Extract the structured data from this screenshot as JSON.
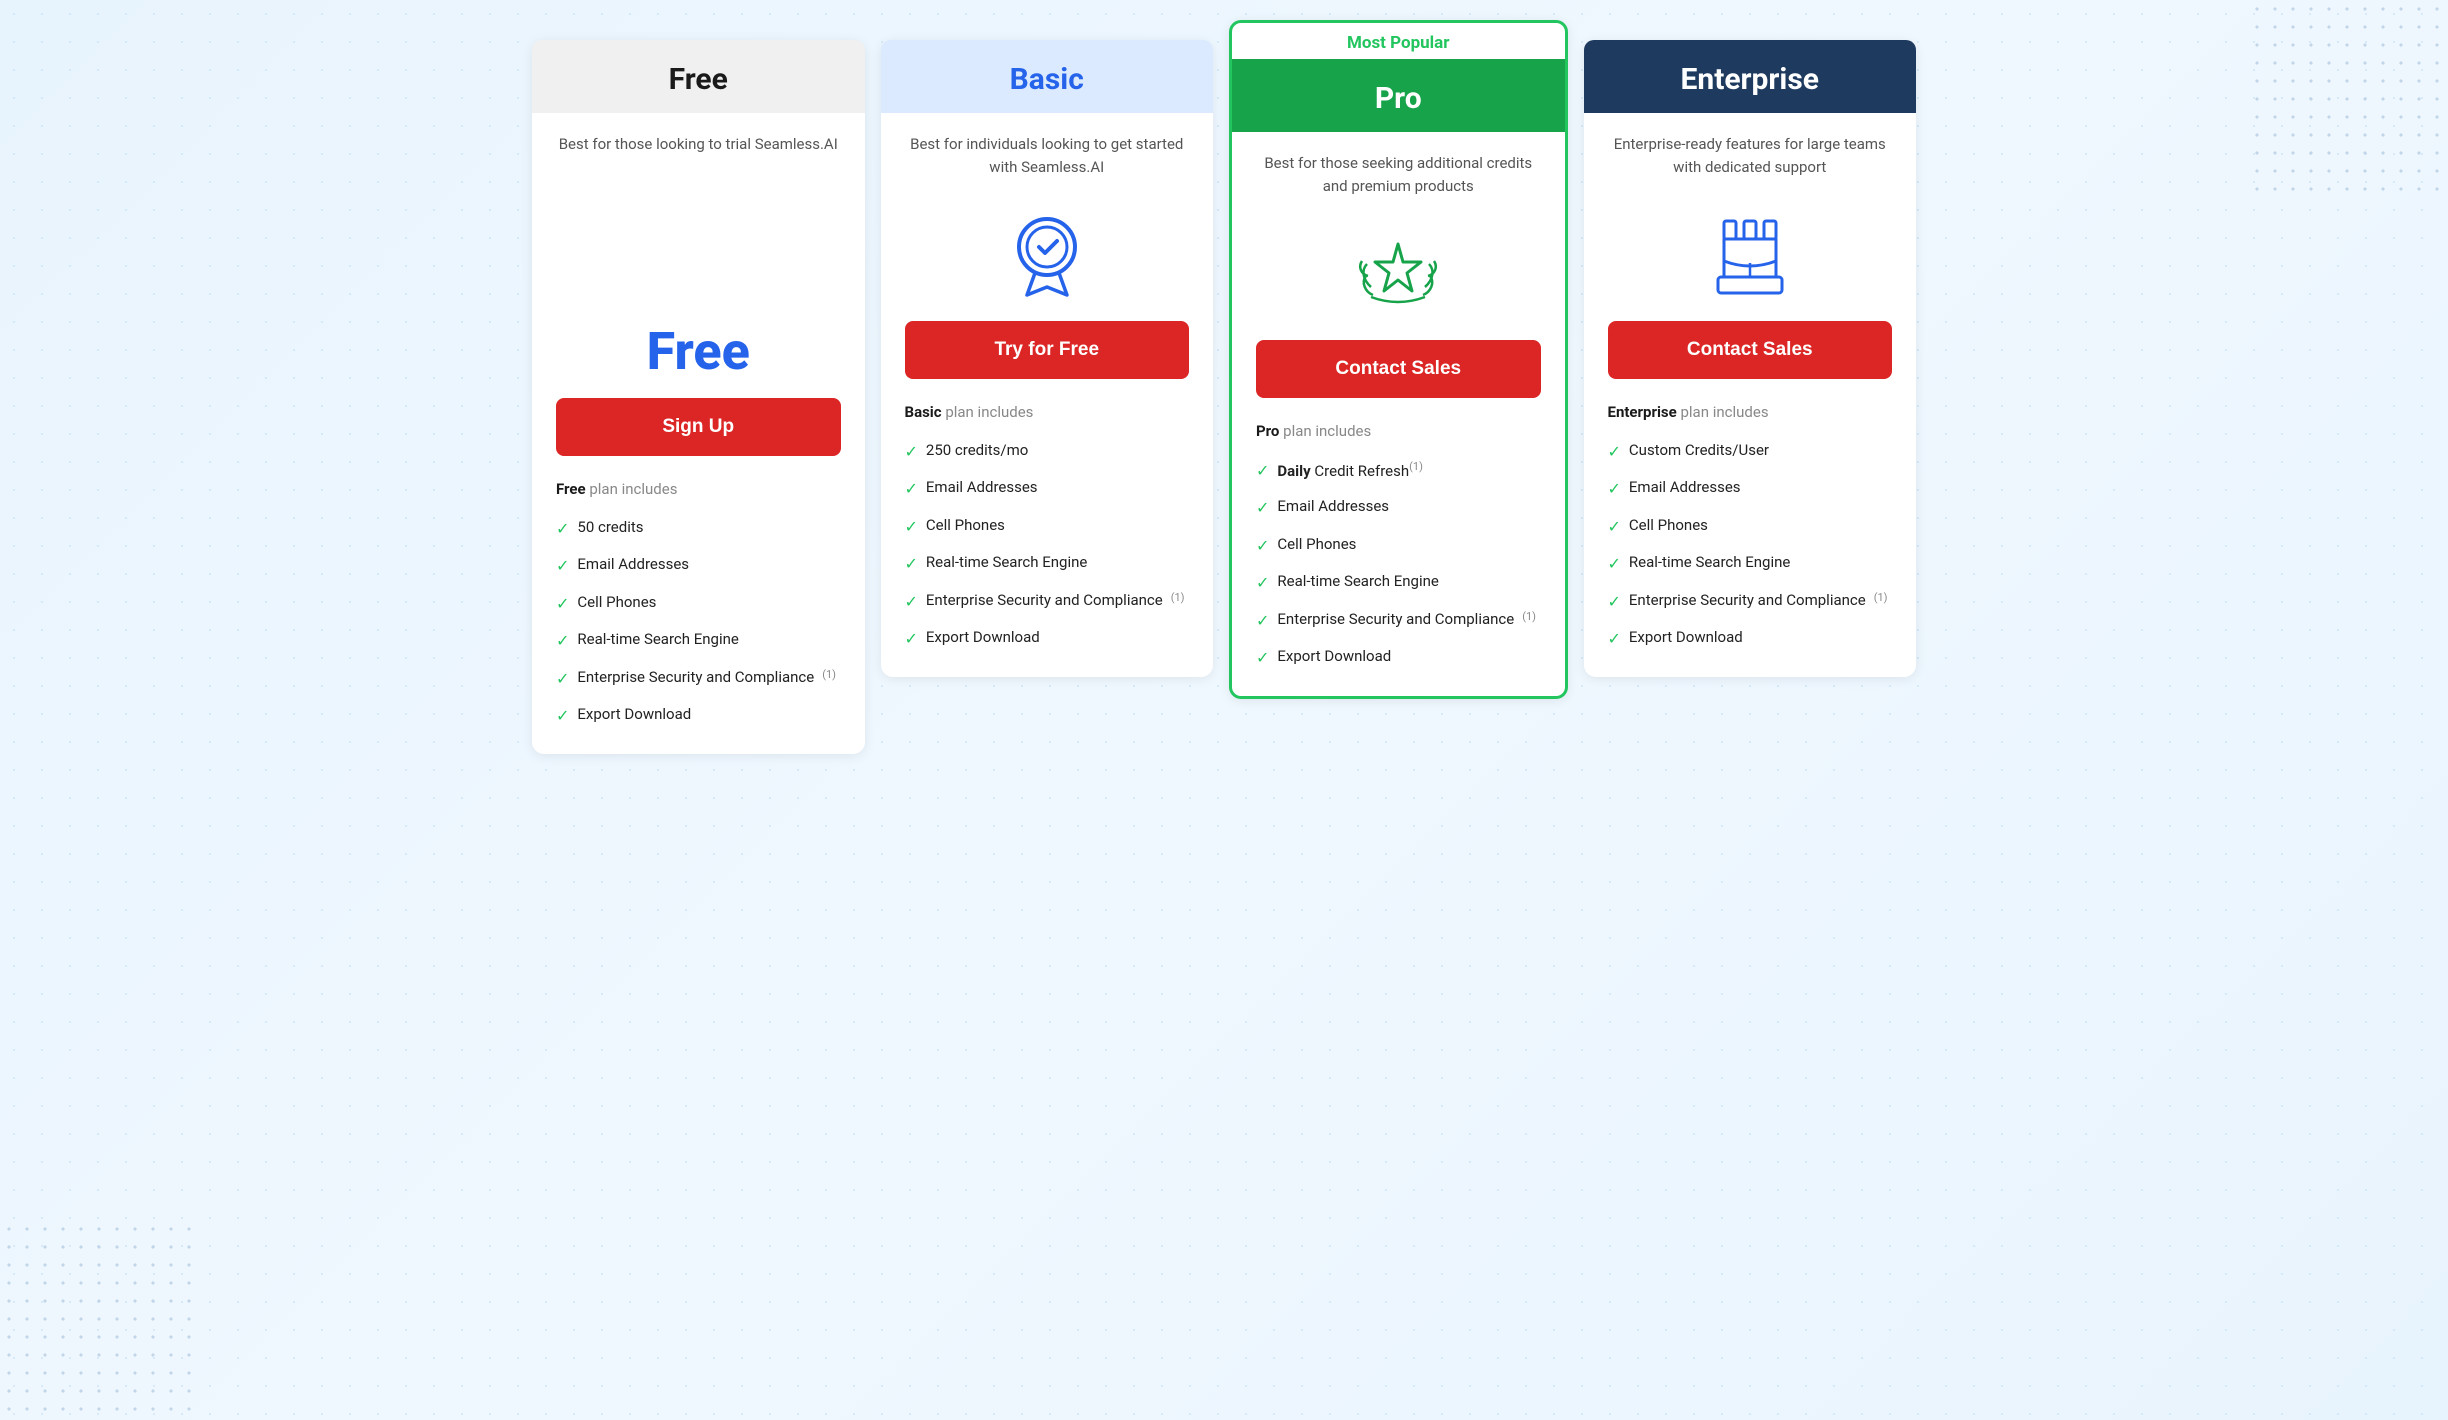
{
  "plans": [
    {
      "id": "free",
      "name": "Free",
      "headerClass": "free-header",
      "nameClass": "free-name",
      "description": "Best for those looking to trial Seamless.AI",
      "icon": "free",
      "price": "Free",
      "cta": "Sign Up",
      "includesLabel": "Free",
      "features": [
        "50 credits",
        "Email Addresses",
        "Cell Phones",
        "Real-time Search Engine",
        "Enterprise Security and Compliance",
        "Export Download"
      ],
      "featureNotes": [
        null,
        null,
        null,
        null,
        "(1)",
        null
      ]
    },
    {
      "id": "basic",
      "name": "Basic",
      "headerClass": "basic-header",
      "nameClass": "basic-name",
      "description": "Best for individuals looking to get started with Seamless.AI",
      "icon": "basic",
      "price": null,
      "cta": "Try for Free",
      "includesLabel": "Basic",
      "features": [
        "250 credits/mo",
        "Email Addresses",
        "Cell Phones",
        "Real-time Search Engine",
        "Enterprise Security and Compliance",
        "Export Download"
      ],
      "featureNotes": [
        null,
        null,
        null,
        null,
        "(1)",
        null
      ]
    },
    {
      "id": "pro",
      "name": "Pro",
      "headerClass": "pro-header",
      "nameClass": "pro-name",
      "description": "Best for those seeking additional credits and premium products",
      "icon": "pro",
      "price": null,
      "cta": "Contact Sales",
      "includesLabel": "Pro",
      "mostPopular": true,
      "features": [
        "Daily Credit Refresh",
        "Email Addresses",
        "Cell Phones",
        "Real-time Search Engine",
        "Enterprise Security and Compliance",
        "Export Download"
      ],
      "featureNotes": [
        "(1)",
        null,
        null,
        null,
        "(1)",
        null
      ],
      "featureBold": [
        "Daily",
        null,
        null,
        null,
        null,
        null
      ]
    },
    {
      "id": "enterprise",
      "name": "Enterprise",
      "headerClass": "enterprise-header",
      "nameClass": "enterprise-name",
      "description": "Enterprise-ready features for large teams with dedicated support",
      "icon": "enterprise",
      "price": null,
      "cta": "Contact Sales",
      "includesLabel": "Enterprise",
      "features": [
        "Custom Credits/User",
        "Email Addresses",
        "Cell Phones",
        "Real-time Search Engine",
        "Enterprise Security and Compliance",
        "Export Download"
      ],
      "featureNotes": [
        null,
        null,
        null,
        null,
        "(1)",
        null
      ]
    }
  ],
  "most_popular_label": "Most Popular"
}
